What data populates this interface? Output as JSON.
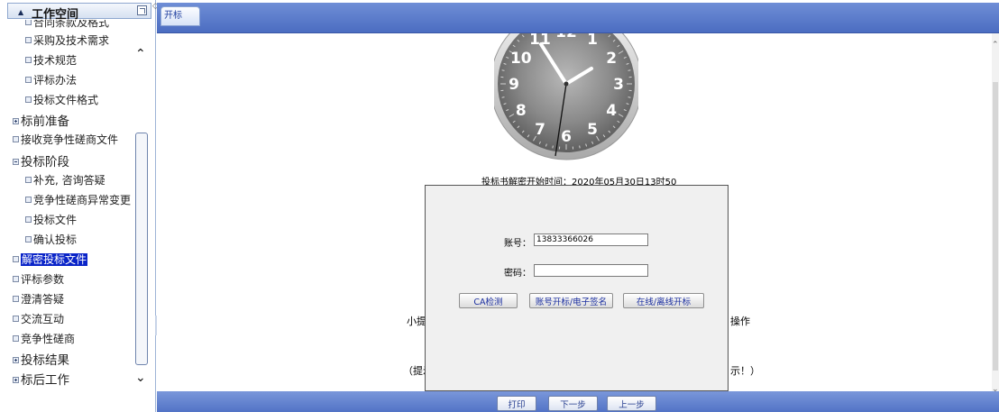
{
  "sidebar": {
    "header_title": "工作空间",
    "items": [
      {
        "label": "合同条款及格式",
        "level": 2,
        "marker": "box"
      },
      {
        "label": "采购及技术需求",
        "level": 2,
        "marker": "box"
      },
      {
        "label": "技术规范",
        "level": 2,
        "marker": "box"
      },
      {
        "label": "评标办法",
        "level": 2,
        "marker": "box"
      },
      {
        "label": "投标文件格式",
        "level": 2,
        "marker": "box"
      },
      {
        "label": "标前准备",
        "level": 1,
        "marker": "plus"
      },
      {
        "label": "接收竞争性磋商文件",
        "level": 1,
        "marker": "box"
      },
      {
        "label": "投标阶段",
        "level": 1,
        "marker": "minus"
      },
      {
        "label": "补充, 咨询答疑",
        "level": 2,
        "marker": "box"
      },
      {
        "label": "竞争性磋商异常变更",
        "level": 2,
        "marker": "box"
      },
      {
        "label": "投标文件",
        "level": 2,
        "marker": "box"
      },
      {
        "label": "确认投标",
        "level": 2,
        "marker": "box"
      },
      {
        "label": "解密投标文件",
        "level": 1,
        "marker": "box",
        "selected": true
      },
      {
        "label": "评标参数",
        "level": 1,
        "marker": "box"
      },
      {
        "label": "澄清答疑",
        "level": 1,
        "marker": "box"
      },
      {
        "label": "交流互动",
        "level": 1,
        "marker": "box"
      },
      {
        "label": "竞争性磋商",
        "level": 1,
        "marker": "box"
      },
      {
        "label": "投标结果",
        "level": 1,
        "marker": "plus"
      },
      {
        "label": "标后工作",
        "level": 1,
        "marker": "plus"
      }
    ]
  },
  "tab": {
    "label": "开标"
  },
  "clock": {
    "numbers": [
      "12",
      "1",
      "2",
      "3",
      "4",
      "5",
      "6",
      "7",
      "8",
      "9",
      "10",
      "11"
    ]
  },
  "main": {
    "decrypt_time_label": "投标书解密开始时间：",
    "decrypt_time_value": "2020年05月30日13时50分",
    "tip_left": "小提",
    "tip_left2": "（提示",
    "tip_right": "操作",
    "tip_right2": "示！）"
  },
  "dialog": {
    "account_label": "账号：",
    "account_value": "13833366026",
    "password_label": "密码：",
    "password_value": "",
    "btn_ca": "CA检测",
    "btn_sign": "账号开标/电子签名",
    "btn_online": "在线/离线开标"
  },
  "footer": {
    "print": "打印",
    "next": "下一步",
    "prev": "上一步"
  },
  "colors": {
    "topbar": "#5a7bcb",
    "selected_bg": "#0a24c8"
  }
}
